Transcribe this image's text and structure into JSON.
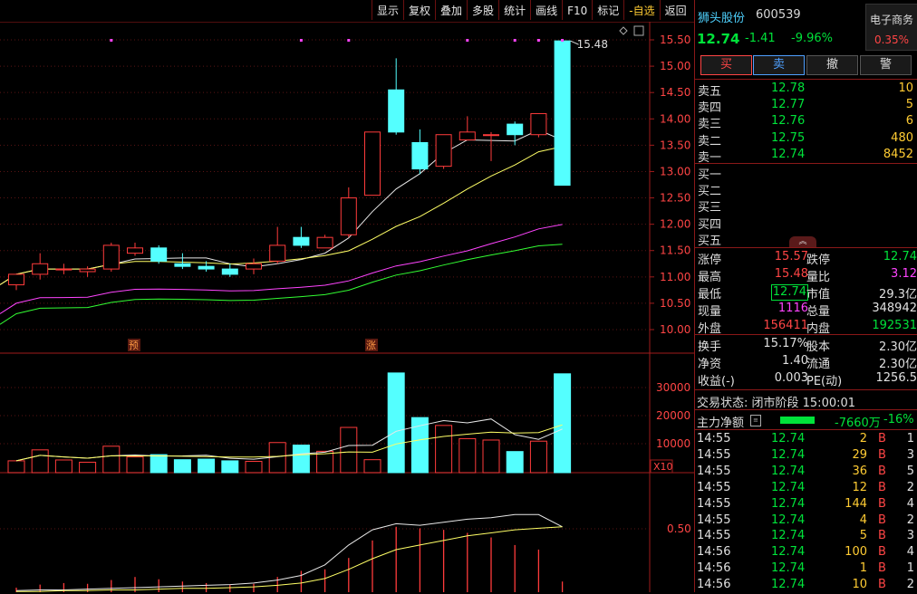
{
  "toolbar": [
    "显示",
    "复权",
    "叠加",
    "多股",
    "统计",
    "画线",
    "F10",
    "标记",
    "-自选",
    "返回"
  ],
  "stock": {
    "name": "狮头股份",
    "code": "600539",
    "price": "12.74",
    "change": "-1.41",
    "change_pct": "-9.96%",
    "sector": "电子商务",
    "sector_pct": "0.35%"
  },
  "actions": [
    "买",
    "卖",
    "撤",
    "警"
  ],
  "sell_book": [
    {
      "label": "卖五",
      "price": "12.78",
      "vol": "10"
    },
    {
      "label": "卖四",
      "price": "12.77",
      "vol": "5"
    },
    {
      "label": "卖三",
      "price": "12.76",
      "vol": "6"
    },
    {
      "label": "卖二",
      "price": "12.75",
      "vol": "480"
    },
    {
      "label": "卖一",
      "price": "12.74",
      "vol": "8452"
    }
  ],
  "buy_book": [
    {
      "label": "买一",
      "price": "",
      "vol": ""
    },
    {
      "label": "买二",
      "price": "",
      "vol": ""
    },
    {
      "label": "买三",
      "price": "",
      "vol": ""
    },
    {
      "label": "买四",
      "price": "",
      "vol": ""
    },
    {
      "label": "买五",
      "price": "",
      "vol": ""
    }
  ],
  "stats": [
    {
      "l1": "涨停",
      "v1": "15.57",
      "c1": "r",
      "l2": "跌停",
      "v2": "12.74",
      "c2": "g"
    },
    {
      "l1": "最高",
      "v1": "15.48",
      "c1": "r",
      "l2": "量比",
      "v2": "3.12",
      "c2": "m"
    },
    {
      "l1": "最低",
      "v1": "12.74",
      "c1": "g",
      "l2": "市值",
      "v2": "29.3亿",
      "c2": "w"
    },
    {
      "l1": "现量",
      "v1": "1116",
      "c1": "m",
      "l2": "总量",
      "v2": "348942",
      "c2": "w"
    },
    {
      "l1": "外盘",
      "v1": "156411",
      "c1": "r",
      "l2": "内盘",
      "v2": "192531",
      "c2": "g"
    }
  ],
  "fund": [
    {
      "l1": "换手",
      "v1": "15.17%",
      "l2": "股本",
      "v2": "2.30亿"
    },
    {
      "l1": "净资",
      "v1": "1.40",
      "l2": "流通",
      "v2": "2.30亿"
    },
    {
      "l1": "收益(-)",
      "v1": "0.003",
      "l2": "PE(动)",
      "v2": "1256.5"
    }
  ],
  "trade_status": "交易状态: 闭市阶段 15:00:01",
  "main_flow": {
    "label": "主力净额",
    "value": "-7660万",
    "pct": "-16%"
  },
  "ticks": [
    {
      "t": "14:55",
      "p": "12.74",
      "v": "2",
      "s": "B",
      "n": "1"
    },
    {
      "t": "14:55",
      "p": "12.74",
      "v": "29",
      "s": "B",
      "n": "3"
    },
    {
      "t": "14:55",
      "p": "12.74",
      "v": "36",
      "s": "B",
      "n": "5"
    },
    {
      "t": "14:55",
      "p": "12.74",
      "v": "12",
      "s": "B",
      "n": "2"
    },
    {
      "t": "14:55",
      "p": "12.74",
      "v": "144",
      "s": "B",
      "n": "4"
    },
    {
      "t": "14:55",
      "p": "12.74",
      "v": "4",
      "s": "B",
      "n": "2"
    },
    {
      "t": "14:55",
      "p": "12.74",
      "v": "5",
      "s": "B",
      "n": "3"
    },
    {
      "t": "14:56",
      "p": "12.74",
      "v": "100",
      "s": "B",
      "n": "4"
    },
    {
      "t": "14:56",
      "p": "12.74",
      "v": "1",
      "s": "B",
      "n": "1"
    },
    {
      "t": "14:56",
      "p": "12.74",
      "v": "10",
      "s": "B",
      "n": "2"
    }
  ],
  "chart_data": {
    "type": "candlestick",
    "price_axis": [
      "15.50",
      "15.00",
      "14.50",
      "14.00",
      "13.50",
      "13.00",
      "12.50",
      "12.00",
      "11.50",
      "11.00",
      "10.50",
      "10.00"
    ],
    "ylim": [
      9.8,
      15.6
    ],
    "high_label": "15.48",
    "markers": [
      {
        "index": 5,
        "text": "预"
      },
      {
        "index": 15,
        "text": "涨"
      }
    ],
    "candles": [
      {
        "o": 10.85,
        "h": 11.05,
        "l": 10.75,
        "c": 11.05
      },
      {
        "o": 11.05,
        "h": 11.45,
        "l": 10.95,
        "c": 11.25
      },
      {
        "o": 11.15,
        "h": 11.25,
        "l": 11.05,
        "c": 11.15
      },
      {
        "o": 11.1,
        "h": 11.2,
        "l": 11.0,
        "c": 11.15
      },
      {
        "o": 11.15,
        "h": 11.65,
        "l": 11.1,
        "c": 11.6
      },
      {
        "o": 11.45,
        "h": 11.65,
        "l": 11.4,
        "c": 11.55
      },
      {
        "o": 11.55,
        "h": 11.6,
        "l": 11.25,
        "c": 11.3
      },
      {
        "o": 11.25,
        "h": 11.45,
        "l": 11.15,
        "c": 11.2
      },
      {
        "o": 11.2,
        "h": 11.3,
        "l": 11.1,
        "c": 11.15
      },
      {
        "o": 11.15,
        "h": 11.25,
        "l": 11.0,
        "c": 11.05
      },
      {
        "o": 11.15,
        "h": 11.35,
        "l": 11.05,
        "c": 11.25
      },
      {
        "o": 11.3,
        "h": 11.95,
        "l": 11.25,
        "c": 11.6
      },
      {
        "o": 11.75,
        "h": 11.95,
        "l": 11.55,
        "c": 11.6
      },
      {
        "o": 11.55,
        "h": 11.8,
        "l": 11.55,
        "c": 11.75
      },
      {
        "o": 11.8,
        "h": 12.7,
        "l": 11.75,
        "c": 12.5
      },
      {
        "o": 12.55,
        "h": 13.75,
        "l": 12.55,
        "c": 13.75
      },
      {
        "o": 14.55,
        "h": 15.15,
        "l": 13.7,
        "c": 13.75
      },
      {
        "o": 13.55,
        "h": 13.8,
        "l": 12.95,
        "c": 13.05
      },
      {
        "o": 13.1,
        "h": 13.7,
        "l": 13.05,
        "c": 13.7
      },
      {
        "o": 13.6,
        "h": 14.05,
        "l": 13.6,
        "c": 13.75
      },
      {
        "o": 13.7,
        "h": 13.75,
        "l": 13.2,
        "c": 13.7
      },
      {
        "o": 13.9,
        "h": 13.95,
        "l": 13.5,
        "c": 13.7
      },
      {
        "o": 13.7,
        "h": 14.1,
        "l": 13.65,
        "c": 14.1
      },
      {
        "o": 15.48,
        "h": 15.48,
        "l": 12.74,
        "c": 12.74
      }
    ],
    "volume_axis": [
      "30000",
      "20000",
      "10000"
    ],
    "volume_unit": "X10",
    "volume": [
      3900,
      7800,
      4200,
      3400,
      9100,
      5300,
      6100,
      4300,
      4500,
      3900,
      3700,
      10400,
      9500,
      7300,
      15800,
      4300,
      35200,
      19300,
      16500,
      11800,
      11300,
      7200,
      10900,
      34900
    ],
    "indicator_axis": [
      "0.50"
    ]
  }
}
